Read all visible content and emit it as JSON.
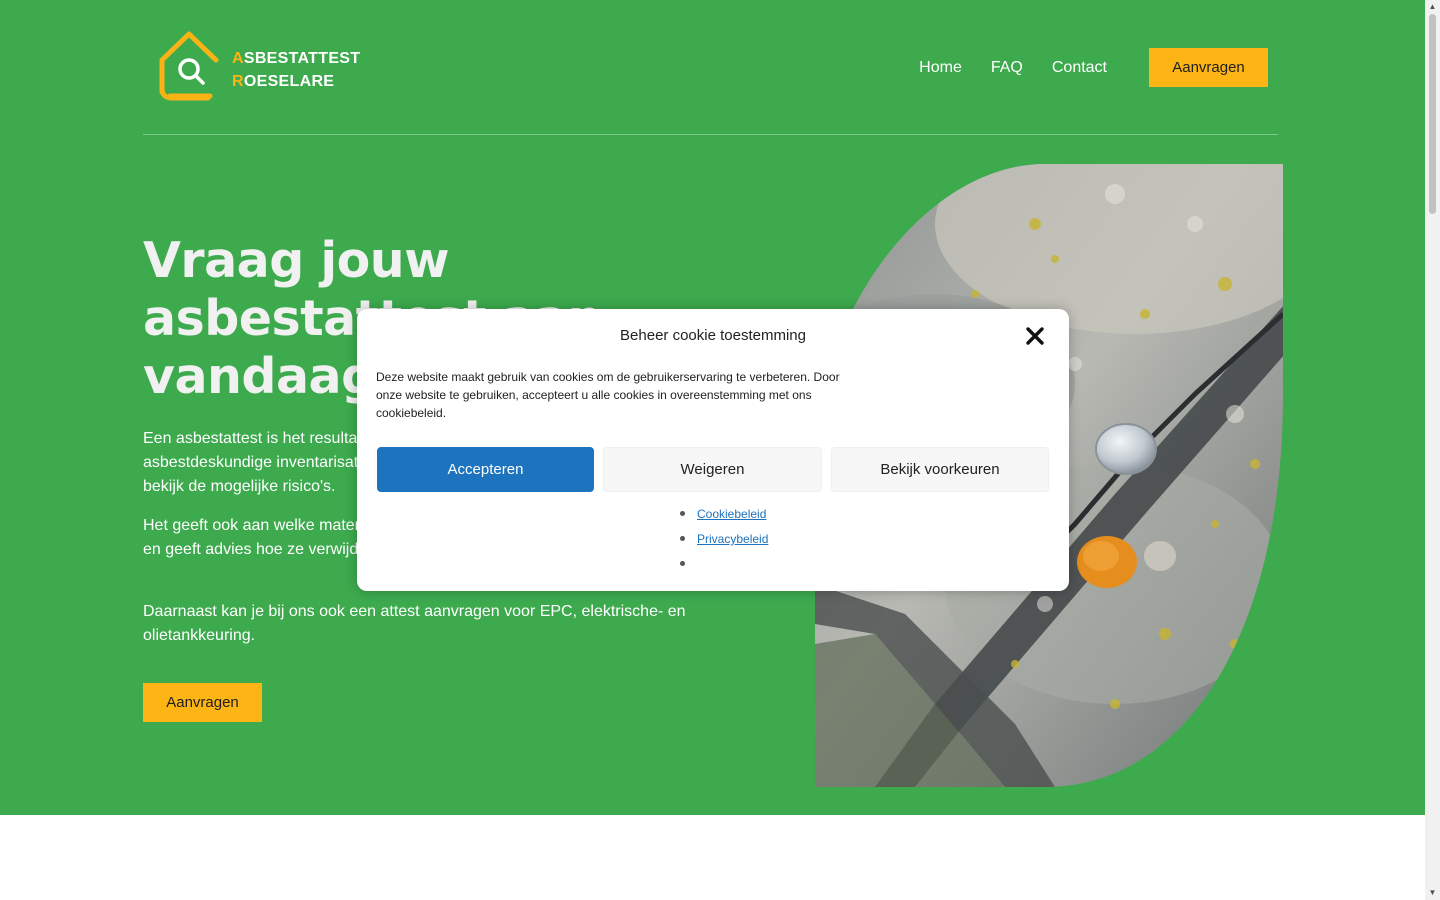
{
  "brand": {
    "line1_initial": "A",
    "line1_rest": "SBESTATTEST",
    "line2_initial": "R",
    "line2_rest": "OESELARE",
    "icon": "house-search-icon"
  },
  "nav": {
    "items": [
      {
        "label": "Home"
      },
      {
        "label": "FAQ"
      },
      {
        "label": "Contact"
      }
    ],
    "cta": "Aanvragen"
  },
  "hero": {
    "title": "Vraag jouw asbestattest aan vandaag",
    "paragraphs": [
      "Een asbestattest is het resultaat van een asbestinventarisatie door een asbestdeskundige inventarisatie. Het toont aan of er asbest in het gebouw en bekijk de mogelijke risico's.",
      "Het geeft ook aan welke materialen asbest bevatten, in welke toestand ze zijn en geeft advies hoe ze verwijderd moeten worden.",
      "Daarnaast kan je bij ons ook een attest aanvragen voor EPC, elektrische- en olietankkeuring."
    ],
    "cta": "Aanvragen",
    "image": "roof-asbestos-nail-photo"
  },
  "cookie_modal": {
    "title": "Beheer cookie toestemming",
    "message": "Deze website maakt gebruik van cookies om de gebruikerservaring te verbeteren. Door onze website te gebruiken, accepteert u alle cookies in overeenstemming met ons cookiebeleid.",
    "accept": "Accepteren",
    "deny": "Weigeren",
    "preferences": "Bekijk voorkeuren",
    "links": [
      {
        "label": "Cookiebeleid"
      },
      {
        "label": "Privacybeleid"
      },
      {
        "label": ""
      }
    ],
    "close_icon": "close-icon"
  },
  "colors": {
    "hero_bg": "#3daa4e",
    "accent": "#fcb514",
    "accept_blue": "#1e73be"
  }
}
